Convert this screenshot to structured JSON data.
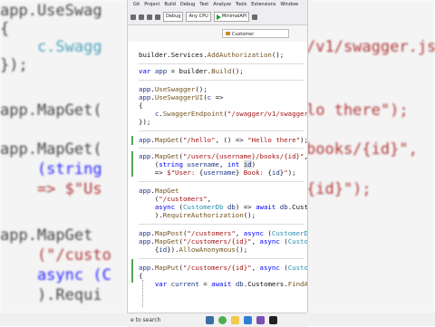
{
  "background": {
    "left_lines": [
      "app.UseSwag",
      "{",
      "    c.Swagg",
      "});",
      "app.MapGet(",
      "app.MapGet(",
      "    (string",
      "    => $\"Us",
      "app.MapGet",
      "    (\"/custo",
      "    async (C",
      "    ).Requi"
    ],
    "right_lines": [
      "/v1/swagger.js",
      "lo there\");",
      "books/{id}\",",
      "{id}\");"
    ]
  },
  "menu": [
    "Git",
    "Project",
    "Build",
    "Debug",
    "Test",
    "Analyze",
    "Tools",
    "Extensions",
    "Window"
  ],
  "toolbar": {
    "config": "Debug",
    "platform": "Any CPU",
    "run_target": "MinimalAPI"
  },
  "nav": {
    "class_combo": "Customer"
  },
  "code": {
    "l1": "builder.Services.AddAuthorization();",
    "l2": "var app = builder.Build();",
    "l3": "app.UseSwagger();",
    "l4": "app.UseSwaggerUI(c =>",
    "l5": "{",
    "l6": "    c.SwaggerEndpoint(\"/swagger/v1/swagger.js",
    "l7": "});",
    "l8": "app.MapGet(\"/hello\", () => \"Hello there\");",
    "l9": "app.MapGet(\"/users/{username}/books/{id}\",",
    "l10": "    (string username, int id)",
    "l11": "    => $\"User: {username} Book: {id}\");",
    "l12": "app.MapGet",
    "l13": "    (\"/customers\",",
    "l14": "    async (CustomerDb db) => await db.Custom",
    "l15": "    ).RequireAuthorization();",
    "l16": "app.MapPost(\"/customers\", async (CustomerDb d",
    "l17": "app.MapGet(\"/customers/{id}\", async (Customer",
    "l18": "    {id}).AllowAnonymous();",
    "l19": "app.MapPut(\"/customers/{id}\", async (Customer",
    "l20": "{",
    "l21": "    var current = await db.Customers.FindAsyn"
  },
  "taskbar": {
    "search_placeholder": "e to search"
  }
}
